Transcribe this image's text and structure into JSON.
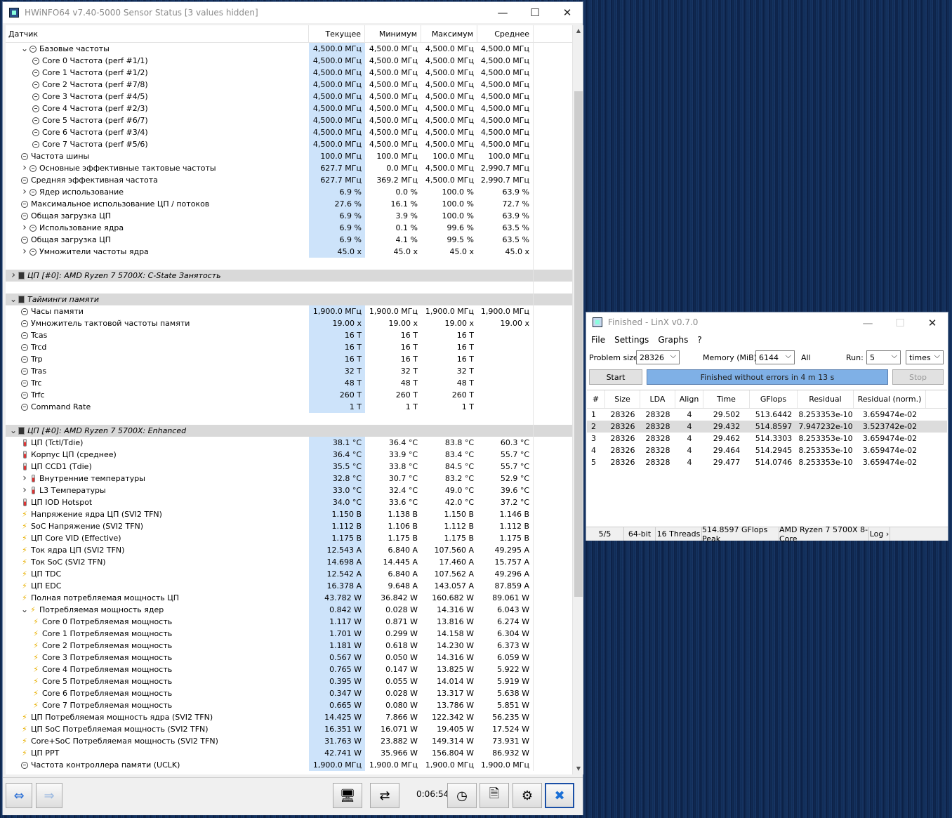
{
  "hwinfo": {
    "title": "HWiNFO64 v7.40-5000 Sensor Status [3 values hidden]",
    "columns": {
      "sensor": "Датчик",
      "current": "Текущее",
      "min": "Минимум",
      "max": "Максимум",
      "avg": "Среднее"
    },
    "timer": "0:06:54",
    "rows": [
      {
        "t": "r",
        "ind": 1,
        "exp": "v",
        "icon": "clock",
        "name": "Базовые частоты",
        "cur": "4,500.0 МГц",
        "min": "4,500.0 МГц",
        "max": "4,500.0 МГц",
        "avg": "4,500.0 МГц"
      },
      {
        "t": "r",
        "ind": 2,
        "icon": "clock",
        "name": "Core 0 Частота (perf #1/1)",
        "cur": "4,500.0 МГц",
        "min": "4,500.0 МГц",
        "max": "4,500.0 МГц",
        "avg": "4,500.0 МГц"
      },
      {
        "t": "r",
        "ind": 2,
        "icon": "clock",
        "name": "Core 1 Частота (perf #1/2)",
        "cur": "4,500.0 МГц",
        "min": "4,500.0 МГц",
        "max": "4,500.0 МГц",
        "avg": "4,500.0 МГц"
      },
      {
        "t": "r",
        "ind": 2,
        "icon": "clock",
        "name": "Core 2 Частота (perf #7/8)",
        "cur": "4,500.0 МГц",
        "min": "4,500.0 МГц",
        "max": "4,500.0 МГц",
        "avg": "4,500.0 МГц"
      },
      {
        "t": "r",
        "ind": 2,
        "icon": "clock",
        "name": "Core 3 Частота (perf #4/5)",
        "cur": "4,500.0 МГц",
        "min": "4,500.0 МГц",
        "max": "4,500.0 МГц",
        "avg": "4,500.0 МГц"
      },
      {
        "t": "r",
        "ind": 2,
        "icon": "clock",
        "name": "Core 4 Частота (perf #2/3)",
        "cur": "4,500.0 МГц",
        "min": "4,500.0 МГц",
        "max": "4,500.0 МГц",
        "avg": "4,500.0 МГц"
      },
      {
        "t": "r",
        "ind": 2,
        "icon": "clock",
        "name": "Core 5 Частота (perf #6/7)",
        "cur": "4,500.0 МГц",
        "min": "4,500.0 МГц",
        "max": "4,500.0 МГц",
        "avg": "4,500.0 МГц"
      },
      {
        "t": "r",
        "ind": 2,
        "icon": "clock",
        "name": "Core 6 Частота (perf #3/4)",
        "cur": "4,500.0 МГц",
        "min": "4,500.0 МГц",
        "max": "4,500.0 МГц",
        "avg": "4,500.0 МГц"
      },
      {
        "t": "r",
        "ind": 2,
        "icon": "clock",
        "name": "Core 7 Частота (perf #5/6)",
        "cur": "4,500.0 МГц",
        "min": "4,500.0 МГц",
        "max": "4,500.0 МГц",
        "avg": "4,500.0 МГц"
      },
      {
        "t": "r",
        "ind": 1,
        "icon": "clock",
        "name": "Частота шины",
        "cur": "100.0 МГц",
        "min": "100.0 МГц",
        "max": "100.0 МГц",
        "avg": "100.0 МГц"
      },
      {
        "t": "r",
        "ind": 1,
        "exp": ">",
        "icon": "clock",
        "name": "Основные эффективные тактовые частоты",
        "cur": "627.7 МГц",
        "min": "0.0 МГц",
        "max": "4,500.0 МГц",
        "avg": "2,990.7 МГц"
      },
      {
        "t": "r",
        "ind": 1,
        "icon": "clock",
        "name": "Средняя эффективная частота",
        "cur": "627.7 МГц",
        "min": "369.2 МГц",
        "max": "4,500.0 МГц",
        "avg": "2,990.7 МГц"
      },
      {
        "t": "r",
        "ind": 1,
        "exp": ">",
        "icon": "clock",
        "name": "Ядер использование",
        "cur": "6.9 %",
        "min": "0.0 %",
        "max": "100.0 %",
        "avg": "63.9 %"
      },
      {
        "t": "r",
        "ind": 1,
        "icon": "clock",
        "name": "Максимальное использование ЦП / потоков",
        "cur": "27.6 %",
        "min": "16.1 %",
        "max": "100.0 %",
        "avg": "72.7 %"
      },
      {
        "t": "r",
        "ind": 1,
        "icon": "clock",
        "name": "Общая загрузка ЦП",
        "cur": "6.9 %",
        "min": "3.9 %",
        "max": "100.0 %",
        "avg": "63.9 %"
      },
      {
        "t": "r",
        "ind": 1,
        "exp": ">",
        "icon": "clock",
        "name": "Использование ядра",
        "cur": "6.9 %",
        "min": "0.1 %",
        "max": "99.6 %",
        "avg": "63.5 %"
      },
      {
        "t": "r",
        "ind": 1,
        "icon": "clock",
        "name": "Общая загрузка ЦП",
        "cur": "6.9 %",
        "min": "4.1 %",
        "max": "99.5 %",
        "avg": "63.5 %"
      },
      {
        "t": "r",
        "ind": 1,
        "exp": ">",
        "icon": "clock",
        "name": "Умножители частоты ядра",
        "cur": "45.0 x",
        "min": "45.0 x",
        "max": "45.0 x",
        "avg": "45.0 x"
      },
      {
        "t": "b"
      },
      {
        "t": "g",
        "exp": ">",
        "name": "ЦП [#0]: AMD Ryzen 7 5700X: C-State Занятость"
      },
      {
        "t": "b"
      },
      {
        "t": "g",
        "exp": "v",
        "name": "Тайминги памяти"
      },
      {
        "t": "r",
        "ind": 1,
        "icon": "clock",
        "name": "Часы памяти",
        "cur": "1,900.0 МГц",
        "min": "1,900.0 МГц",
        "max": "1,900.0 МГц",
        "avg": "1,900.0 МГц"
      },
      {
        "t": "r",
        "ind": 1,
        "icon": "clock",
        "name": "Умножитель тактовой частоты памяти",
        "cur": "19.00 x",
        "min": "19.00 x",
        "max": "19.00 x",
        "avg": "19.00 x"
      },
      {
        "t": "r",
        "ind": 1,
        "icon": "clock",
        "name": "Tcas",
        "cur": "16 T",
        "min": "16 T",
        "max": "16 T",
        "avg": ""
      },
      {
        "t": "r",
        "ind": 1,
        "icon": "clock",
        "name": "Trcd",
        "cur": "16 T",
        "min": "16 T",
        "max": "16 T",
        "avg": ""
      },
      {
        "t": "r",
        "ind": 1,
        "icon": "clock",
        "name": "Trp",
        "cur": "16 T",
        "min": "16 T",
        "max": "16 T",
        "avg": ""
      },
      {
        "t": "r",
        "ind": 1,
        "icon": "clock",
        "name": "Tras",
        "cur": "32 T",
        "min": "32 T",
        "max": "32 T",
        "avg": ""
      },
      {
        "t": "r",
        "ind": 1,
        "icon": "clock",
        "name": "Trc",
        "cur": "48 T",
        "min": "48 T",
        "max": "48 T",
        "avg": ""
      },
      {
        "t": "r",
        "ind": 1,
        "icon": "clock",
        "name": "Trfc",
        "cur": "260 T",
        "min": "260 T",
        "max": "260 T",
        "avg": ""
      },
      {
        "t": "r",
        "ind": 1,
        "icon": "clock",
        "name": "Command Rate",
        "cur": "1 T",
        "min": "1 T",
        "max": "1 T",
        "avg": ""
      },
      {
        "t": "b"
      },
      {
        "t": "g",
        "exp": "v",
        "name": "ЦП [#0]: AMD Ryzen 7 5700X: Enhanced"
      },
      {
        "t": "r",
        "ind": 1,
        "icon": "therm",
        "name": "ЦП (Tctl/Tdie)",
        "cur": "38.1 °C",
        "min": "36.4 °C",
        "max": "83.8 °C",
        "avg": "60.3 °C"
      },
      {
        "t": "r",
        "ind": 1,
        "icon": "therm",
        "name": "Корпус ЦП (среднее)",
        "cur": "36.4 °C",
        "min": "33.9 °C",
        "max": "83.4 °C",
        "avg": "55.7 °C"
      },
      {
        "t": "r",
        "ind": 1,
        "icon": "therm",
        "name": "ЦП CCD1 (Tdie)",
        "cur": "35.5 °C",
        "min": "33.8 °C",
        "max": "84.5 °C",
        "avg": "55.7 °C"
      },
      {
        "t": "r",
        "ind": 1,
        "exp": ">",
        "icon": "therm",
        "name": "Внутренние температуры",
        "cur": "32.8 °C",
        "min": "30.7 °C",
        "max": "83.2 °C",
        "avg": "52.9 °C"
      },
      {
        "t": "r",
        "ind": 1,
        "exp": ">",
        "icon": "therm",
        "name": "L3 Температуры",
        "cur": "33.0 °C",
        "min": "32.4 °C",
        "max": "49.0 °C",
        "avg": "39.6 °C"
      },
      {
        "t": "r",
        "ind": 1,
        "icon": "therm",
        "name": "ЦП IOD Hotspot",
        "cur": "34.0 °C",
        "min": "33.6 °C",
        "max": "42.0 °C",
        "avg": "37.2 °C"
      },
      {
        "t": "r",
        "ind": 1,
        "icon": "bolt",
        "name": "Напряжение ядра ЦП (SVI2 TFN)",
        "cur": "1.150 В",
        "min": "1.138 В",
        "max": "1.150 В",
        "avg": "1.146 В"
      },
      {
        "t": "r",
        "ind": 1,
        "icon": "bolt",
        "name": "SoC Напряжение (SVI2 TFN)",
        "cur": "1.112 В",
        "min": "1.106 В",
        "max": "1.112 В",
        "avg": "1.112 В"
      },
      {
        "t": "r",
        "ind": 1,
        "icon": "bolt",
        "name": "ЦП Core VID (Effective)",
        "cur": "1.175 В",
        "min": "1.175 В",
        "max": "1.175 В",
        "avg": "1.175 В"
      },
      {
        "t": "r",
        "ind": 1,
        "icon": "bolt",
        "name": "Ток ядра ЦП (SVI2 TFN)",
        "cur": "12.543 A",
        "min": "6.840 A",
        "max": "107.560 A",
        "avg": "49.295 A"
      },
      {
        "t": "r",
        "ind": 1,
        "icon": "bolt",
        "name": "Ток SoC (SVI2 TFN)",
        "cur": "14.698 A",
        "min": "14.445 A",
        "max": "17.460 A",
        "avg": "15.757 A"
      },
      {
        "t": "r",
        "ind": 1,
        "icon": "bolt",
        "name": "ЦП TDC",
        "cur": "12.542 A",
        "min": "6.840 A",
        "max": "107.562 A",
        "avg": "49.296 A"
      },
      {
        "t": "r",
        "ind": 1,
        "icon": "bolt",
        "name": "ЦП EDC",
        "cur": "16.378 A",
        "min": "9.648 A",
        "max": "143.057 A",
        "avg": "87.859 A"
      },
      {
        "t": "r",
        "ind": 1,
        "icon": "bolt",
        "name": "Полная потребляемая мощность ЦП",
        "cur": "43.782 W",
        "min": "36.842 W",
        "max": "160.682 W",
        "avg": "89.061 W"
      },
      {
        "t": "r",
        "ind": 1,
        "exp": "v",
        "icon": "bolt",
        "name": "Потребляемая мощность ядер",
        "cur": "0.842 W",
        "min": "0.028 W",
        "max": "14.316 W",
        "avg": "6.043 W"
      },
      {
        "t": "r",
        "ind": 2,
        "icon": "bolt",
        "name": "Core 0 Потребляемая мощность",
        "cur": "1.117 W",
        "min": "0.871 W",
        "max": "13.816 W",
        "avg": "6.274 W"
      },
      {
        "t": "r",
        "ind": 2,
        "icon": "bolt",
        "name": "Core 1 Потребляемая мощность",
        "cur": "1.701 W",
        "min": "0.299 W",
        "max": "14.158 W",
        "avg": "6.304 W"
      },
      {
        "t": "r",
        "ind": 2,
        "icon": "bolt",
        "name": "Core 2 Потребляемая мощность",
        "cur": "1.181 W",
        "min": "0.618 W",
        "max": "14.230 W",
        "avg": "6.373 W"
      },
      {
        "t": "r",
        "ind": 2,
        "icon": "bolt",
        "name": "Core 3 Потребляемая мощность",
        "cur": "0.567 W",
        "min": "0.050 W",
        "max": "14.316 W",
        "avg": "6.059 W"
      },
      {
        "t": "r",
        "ind": 2,
        "icon": "bolt",
        "name": "Core 4 Потребляемая мощность",
        "cur": "0.765 W",
        "min": "0.147 W",
        "max": "13.825 W",
        "avg": "5.922 W"
      },
      {
        "t": "r",
        "ind": 2,
        "icon": "bolt",
        "name": "Core 5 Потребляемая мощность",
        "cur": "0.395 W",
        "min": "0.055 W",
        "max": "14.014 W",
        "avg": "5.919 W"
      },
      {
        "t": "r",
        "ind": 2,
        "icon": "bolt",
        "name": "Core 6 Потребляемая мощность",
        "cur": "0.347 W",
        "min": "0.028 W",
        "max": "13.317 W",
        "avg": "5.638 W"
      },
      {
        "t": "r",
        "ind": 2,
        "icon": "bolt",
        "name": "Core 7 Потребляемая мощность",
        "cur": "0.665 W",
        "min": "0.080 W",
        "max": "13.786 W",
        "avg": "5.851 W"
      },
      {
        "t": "r",
        "ind": 1,
        "icon": "bolt",
        "name": "ЦП Потребляемая мощность ядра (SVI2 TFN)",
        "cur": "14.425 W",
        "min": "7.866 W",
        "max": "122.342 W",
        "avg": "56.235 W"
      },
      {
        "t": "r",
        "ind": 1,
        "icon": "bolt",
        "name": "ЦП SoC Потребляемая мощность (SVI2 TFN)",
        "cur": "16.351 W",
        "min": "16.071 W",
        "max": "19.405 W",
        "avg": "17.524 W"
      },
      {
        "t": "r",
        "ind": 1,
        "icon": "bolt",
        "name": "Core+SoC Потребляемая мощность (SVI2 TFN)",
        "cur": "31.763 W",
        "min": "23.882 W",
        "max": "149.314 W",
        "avg": "73.931 W"
      },
      {
        "t": "r",
        "ind": 1,
        "icon": "bolt",
        "name": "ЦП PPT",
        "cur": "42.741 W",
        "min": "35.966 W",
        "max": "156.804 W",
        "avg": "86.932 W"
      },
      {
        "t": "r",
        "ind": 1,
        "icon": "clock",
        "name": "Частота контроллера памяти (UCLK)",
        "cur": "1,900.0 МГц",
        "min": "1,900.0 МГц",
        "max": "1,900.0 МГц",
        "avg": "1,900.0 МГц"
      }
    ]
  },
  "linx": {
    "title": "Finished - LinX v0.7.0",
    "menu": [
      "File",
      "Settings",
      "Graphs",
      "?"
    ],
    "problem_label": "Problem size:",
    "problem_value": "28326",
    "memory_label": "Memory (MiB):",
    "memory_value": "6144",
    "all_label": "All",
    "run_label": "Run:",
    "run_value": "5",
    "run_unit": "times",
    "start_label": "Start",
    "status": "Finished without errors in 4 m 13 s",
    "stop_label": "Stop",
    "headers": [
      "#",
      "Size",
      "LDA",
      "Align",
      "Time",
      "GFlops",
      "Residual",
      "Residual (norm.)"
    ],
    "results": [
      [
        "1",
        "28326",
        "28328",
        "4",
        "29.502",
        "513.6442",
        "8.253353e-10",
        "3.659474e-02"
      ],
      [
        "2",
        "28326",
        "28328",
        "4",
        "29.432",
        "514.8597",
        "7.947232e-10",
        "3.523742e-02"
      ],
      [
        "3",
        "28326",
        "28328",
        "4",
        "29.462",
        "514.3303",
        "8.253353e-10",
        "3.659474e-02"
      ],
      [
        "4",
        "28326",
        "28328",
        "4",
        "29.464",
        "514.2945",
        "8.253353e-10",
        "3.659474e-02"
      ],
      [
        "5",
        "28326",
        "28328",
        "4",
        "29.477",
        "514.0746",
        "8.253353e-10",
        "3.659474e-02"
      ]
    ],
    "statusbar": [
      "5/5",
      "64-bit",
      "16 Threads",
      "514.8597 GFlops Peak",
      "AMD Ryzen 7 5700X 8-Core",
      "Log ›"
    ]
  }
}
